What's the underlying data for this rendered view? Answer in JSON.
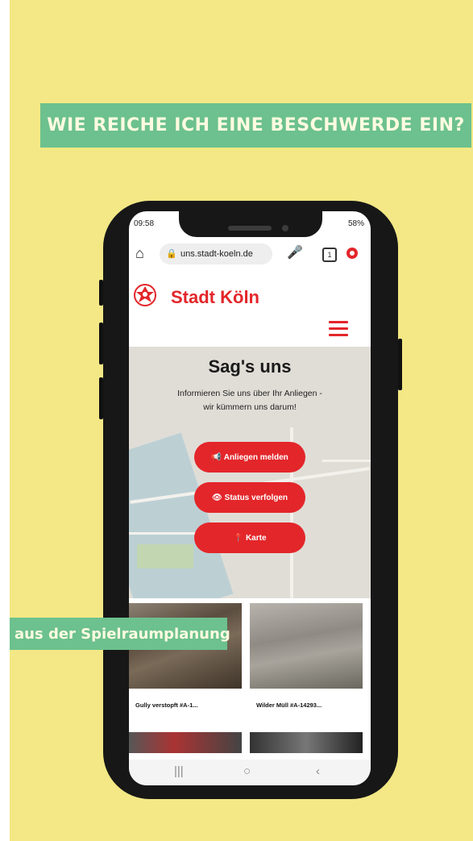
{
  "headline": "WIE REICHE ICH EINE BESCHWERDE EIN?",
  "side_caption": "aus der Spielraumplanung",
  "phone": {
    "status_time": "09:58",
    "status_right": "58%",
    "url": "uns.stadt-koeln.de",
    "tab_count": "1",
    "icons": [
      "home-icon",
      "lock-icon",
      "mic-icon",
      "tabs-icon",
      "menu-icon",
      "hamburger-icon",
      "recents-icon",
      "home-nav-icon",
      "back-icon"
    ],
    "brand": {
      "name": "Stadt Köln",
      "color": "#e3262a"
    },
    "hero": {
      "title": "Sag's uns",
      "subtitle": "Informieren Sie uns über Ihr Anliegen - wir kümmern uns darum!",
      "buttons": [
        {
          "icon": "📢",
          "label": "Anliegen melden"
        },
        {
          "icon": "👁",
          "label": "Status verfolgen"
        },
        {
          "icon": "📍",
          "label": "Karte"
        }
      ]
    },
    "cards": [
      {
        "title": "Gully verstopft #A-1..."
      },
      {
        "title": "Wilder Müll #A-14293..."
      }
    ]
  },
  "colors": {
    "background": "#f3e885",
    "caption_bg": "#6cc18e",
    "caption_text": "#fffbe0",
    "button_red": "#e3262a"
  }
}
